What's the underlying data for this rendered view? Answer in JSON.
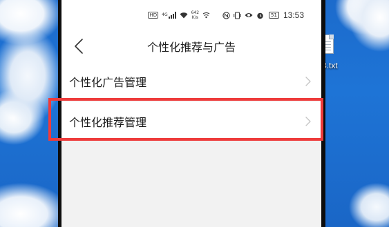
{
  "desktop": {
    "file_label": "3.txt",
    "file_icon": "text-file-icon"
  },
  "status_bar": {
    "hd_badge": "HD",
    "signal_label": "4G",
    "net_speed_value": "642",
    "net_speed_unit": "K/s",
    "battery": "51",
    "time": "13:53",
    "icons": [
      "hd-icon",
      "cellular-signal-icon",
      "wifi-icon",
      "hotspot-icon",
      "nfc-icon",
      "vibrate-icon",
      "eye-comfort-icon",
      "alarm-icon",
      "battery-icon"
    ]
  },
  "header": {
    "title": "个性化推荐与广告",
    "back_icon": "back-chevron-icon"
  },
  "menu": {
    "items": [
      {
        "label": "个性化广告管理",
        "icon": "chevron-right-icon"
      },
      {
        "label": "个性化推荐管理",
        "icon": "chevron-right-icon",
        "highlighted": true
      }
    ]
  },
  "colors": {
    "highlight_border": "#ee3b3b",
    "screen_background": "#f2f2f2",
    "desktop_sky": "#1c6bcc"
  }
}
